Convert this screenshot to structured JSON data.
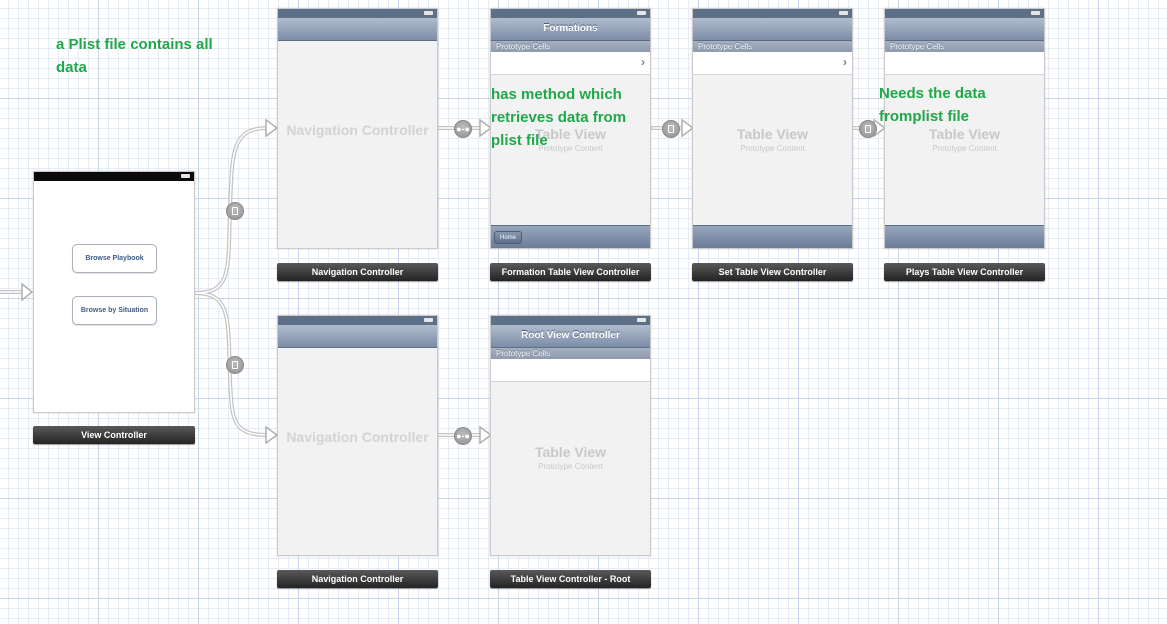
{
  "notes": {
    "plist_note": "a Plist file contains all data",
    "method_note": "has method which retrieves data from plist file",
    "needs_note": "Needs the data fromplist file"
  },
  "scenes": {
    "view_controller": {
      "caption": "View Controller",
      "buttons": [
        "Browse Playbook",
        "Browse by Situation"
      ]
    },
    "nav_top": {
      "caption": "Navigation Controller",
      "ghost": "Navigation Controller"
    },
    "nav_bottom": {
      "caption": "Navigation Controller",
      "ghost": "Navigation Controller"
    },
    "formation": {
      "caption": "Formation Table View Controller",
      "title": "Formations",
      "section": "Prototype Cells",
      "ghost_title": "Table View",
      "ghost_sub": "Prototype Content",
      "home_button": "Home"
    },
    "set": {
      "caption": "Set Table View Controller",
      "section": "Prototype Cells",
      "ghost_title": "Table View",
      "ghost_sub": "Prototype Content"
    },
    "plays": {
      "caption": "Plays Table View Controller",
      "section": "Prototype Cells",
      "ghost_title": "Table View",
      "ghost_sub": "Prototype Content"
    },
    "root": {
      "caption": "Table View Controller - Root",
      "title": "Root View Controller",
      "section": "Prototype Cells",
      "ghost_title": "Table View",
      "ghost_sub": "Prototype Content"
    }
  },
  "colors": {
    "note_green": "#1fa84a",
    "navbar_blue": "#7d8da8",
    "grid_line": "#c9d6ea"
  },
  "icons": {
    "push_segue": "push-segue-icon",
    "relationship_segue": "relationship-segue-icon",
    "modal_segue": "modal-segue-icon"
  }
}
